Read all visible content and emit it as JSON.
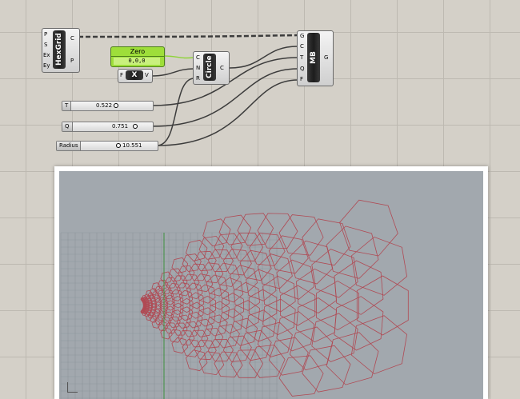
{
  "components": {
    "hexgrid": {
      "name": "HexGrid",
      "inputs": [
        "P",
        "S",
        "Ex",
        "Ey"
      ],
      "outputs": [
        "C",
        "P"
      ]
    },
    "zero": {
      "name": "Zero",
      "value": "0,0,0"
    },
    "x_vector": {
      "name": "X",
      "inputs": [
        "F"
      ],
      "outputs": [
        "V"
      ]
    },
    "circle": {
      "name": "Circle",
      "inputs": [
        "C",
        "N",
        "R"
      ],
      "outputs": [
        "C"
      ]
    },
    "mb": {
      "name": "MB",
      "inputs": [
        "G",
        "C",
        "T",
        "Q",
        "F"
      ],
      "outputs": [
        "G"
      ]
    }
  },
  "sliders": [
    {
      "label": "T",
      "value": "0.522",
      "fraction": 0.52
    },
    {
      "label": "Q",
      "value": "0.751",
      "fraction": 0.75
    },
    {
      "label": "Radius",
      "value": "10.551",
      "fraction": 0.5
    }
  ],
  "colors": {
    "canvas": "#d4d0c8",
    "zero_green": "#9ede3a",
    "viewport": "#a2a8ae",
    "mesh": "#b04a54",
    "wire": "#3c3c3c"
  },
  "icons": [
    "axis-icon"
  ]
}
